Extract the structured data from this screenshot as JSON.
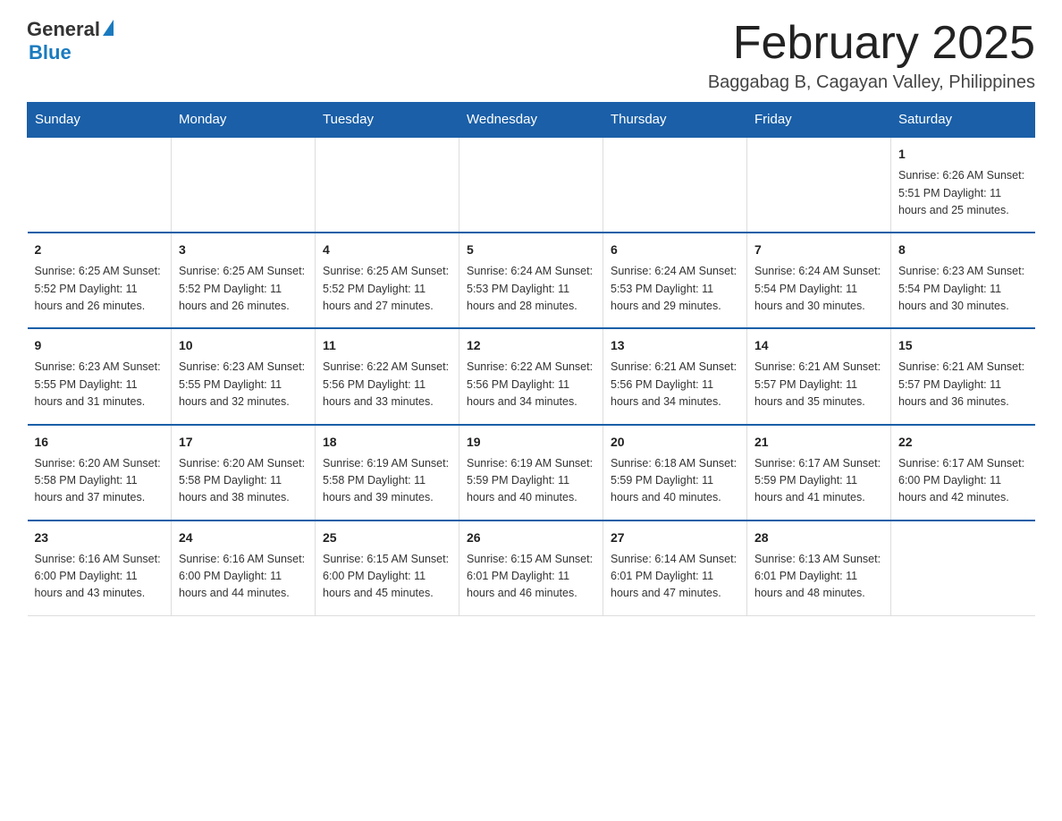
{
  "logo": {
    "text_general": "General",
    "text_blue": "Blue"
  },
  "title": "February 2025",
  "subtitle": "Baggabag B, Cagayan Valley, Philippines",
  "days_of_week": [
    "Sunday",
    "Monday",
    "Tuesday",
    "Wednesday",
    "Thursday",
    "Friday",
    "Saturday"
  ],
  "weeks": [
    [
      {
        "day": "",
        "info": ""
      },
      {
        "day": "",
        "info": ""
      },
      {
        "day": "",
        "info": ""
      },
      {
        "day": "",
        "info": ""
      },
      {
        "day": "",
        "info": ""
      },
      {
        "day": "",
        "info": ""
      },
      {
        "day": "1",
        "info": "Sunrise: 6:26 AM\nSunset: 5:51 PM\nDaylight: 11 hours and 25 minutes."
      }
    ],
    [
      {
        "day": "2",
        "info": "Sunrise: 6:25 AM\nSunset: 5:52 PM\nDaylight: 11 hours and 26 minutes."
      },
      {
        "day": "3",
        "info": "Sunrise: 6:25 AM\nSunset: 5:52 PM\nDaylight: 11 hours and 26 minutes."
      },
      {
        "day": "4",
        "info": "Sunrise: 6:25 AM\nSunset: 5:52 PM\nDaylight: 11 hours and 27 minutes."
      },
      {
        "day": "5",
        "info": "Sunrise: 6:24 AM\nSunset: 5:53 PM\nDaylight: 11 hours and 28 minutes."
      },
      {
        "day": "6",
        "info": "Sunrise: 6:24 AM\nSunset: 5:53 PM\nDaylight: 11 hours and 29 minutes."
      },
      {
        "day": "7",
        "info": "Sunrise: 6:24 AM\nSunset: 5:54 PM\nDaylight: 11 hours and 30 minutes."
      },
      {
        "day": "8",
        "info": "Sunrise: 6:23 AM\nSunset: 5:54 PM\nDaylight: 11 hours and 30 minutes."
      }
    ],
    [
      {
        "day": "9",
        "info": "Sunrise: 6:23 AM\nSunset: 5:55 PM\nDaylight: 11 hours and 31 minutes."
      },
      {
        "day": "10",
        "info": "Sunrise: 6:23 AM\nSunset: 5:55 PM\nDaylight: 11 hours and 32 minutes."
      },
      {
        "day": "11",
        "info": "Sunrise: 6:22 AM\nSunset: 5:56 PM\nDaylight: 11 hours and 33 minutes."
      },
      {
        "day": "12",
        "info": "Sunrise: 6:22 AM\nSunset: 5:56 PM\nDaylight: 11 hours and 34 minutes."
      },
      {
        "day": "13",
        "info": "Sunrise: 6:21 AM\nSunset: 5:56 PM\nDaylight: 11 hours and 34 minutes."
      },
      {
        "day": "14",
        "info": "Sunrise: 6:21 AM\nSunset: 5:57 PM\nDaylight: 11 hours and 35 minutes."
      },
      {
        "day": "15",
        "info": "Sunrise: 6:21 AM\nSunset: 5:57 PM\nDaylight: 11 hours and 36 minutes."
      }
    ],
    [
      {
        "day": "16",
        "info": "Sunrise: 6:20 AM\nSunset: 5:58 PM\nDaylight: 11 hours and 37 minutes."
      },
      {
        "day": "17",
        "info": "Sunrise: 6:20 AM\nSunset: 5:58 PM\nDaylight: 11 hours and 38 minutes."
      },
      {
        "day": "18",
        "info": "Sunrise: 6:19 AM\nSunset: 5:58 PM\nDaylight: 11 hours and 39 minutes."
      },
      {
        "day": "19",
        "info": "Sunrise: 6:19 AM\nSunset: 5:59 PM\nDaylight: 11 hours and 40 minutes."
      },
      {
        "day": "20",
        "info": "Sunrise: 6:18 AM\nSunset: 5:59 PM\nDaylight: 11 hours and 40 minutes."
      },
      {
        "day": "21",
        "info": "Sunrise: 6:17 AM\nSunset: 5:59 PM\nDaylight: 11 hours and 41 minutes."
      },
      {
        "day": "22",
        "info": "Sunrise: 6:17 AM\nSunset: 6:00 PM\nDaylight: 11 hours and 42 minutes."
      }
    ],
    [
      {
        "day": "23",
        "info": "Sunrise: 6:16 AM\nSunset: 6:00 PM\nDaylight: 11 hours and 43 minutes."
      },
      {
        "day": "24",
        "info": "Sunrise: 6:16 AM\nSunset: 6:00 PM\nDaylight: 11 hours and 44 minutes."
      },
      {
        "day": "25",
        "info": "Sunrise: 6:15 AM\nSunset: 6:00 PM\nDaylight: 11 hours and 45 minutes."
      },
      {
        "day": "26",
        "info": "Sunrise: 6:15 AM\nSunset: 6:01 PM\nDaylight: 11 hours and 46 minutes."
      },
      {
        "day": "27",
        "info": "Sunrise: 6:14 AM\nSunset: 6:01 PM\nDaylight: 11 hours and 47 minutes."
      },
      {
        "day": "28",
        "info": "Sunrise: 6:13 AM\nSunset: 6:01 PM\nDaylight: 11 hours and 48 minutes."
      },
      {
        "day": "",
        "info": ""
      }
    ]
  ]
}
